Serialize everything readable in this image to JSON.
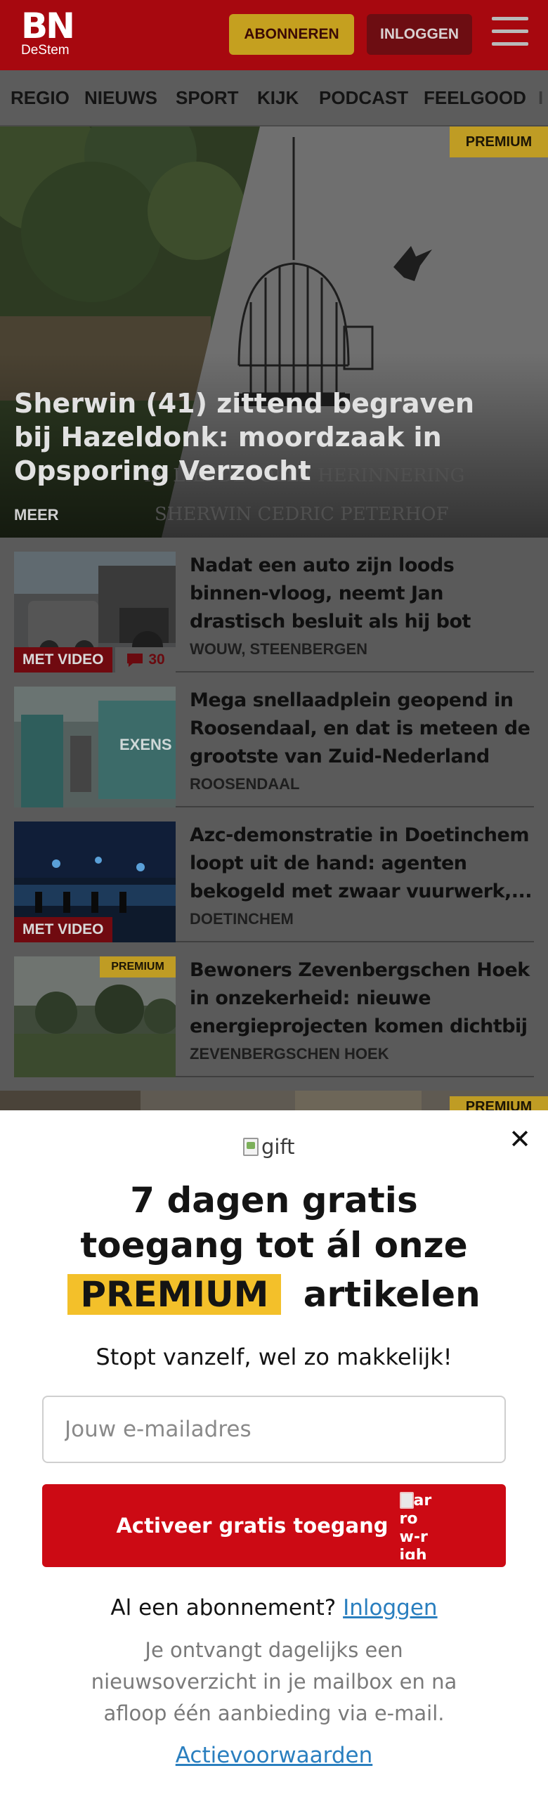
{
  "header": {
    "logo_main": "BN",
    "logo_sub": "DeStem",
    "subscribe_label": "ABONNEREN",
    "login_label": "INLOGGEN"
  },
  "nav": {
    "items": [
      "REGIO",
      "NIEUWS",
      "SPORT",
      "KIJK",
      "PODCAST",
      "FEELGOOD"
    ]
  },
  "hero": {
    "badge": "PREMIUM",
    "title": "Sherwin (41) zittend begraven bij Hazeldonk: moordzaak in Opsporing Verzocht",
    "more": "MEER",
    "image_caption_1": "IN LIEFDEVOLLE HERINNERING",
    "image_caption_2": "SHERWIN CEDRIC PETERHOF"
  },
  "articles": [
    {
      "title": "Nadat een auto zijn loods binnen-vloog, neemt Jan drastisch besluit als hij bot vangt bij politie",
      "location": "WOUW, STEENBERGEN",
      "video_tag": "MET VIDEO",
      "comments": "30"
    },
    {
      "title": "Mega snellaadplein geopend in Roosendaal, en dat is meteen de grootste van Zuid-Nederland",
      "location": "ROOSENDAAL",
      "thumb_text": "EXENS"
    },
    {
      "title": "Azc-demonstratie in Doetinchem loopt uit de hand: agenten bekogeld met zwaar vuurwerk,...",
      "location": "DOETINCHEM",
      "video_tag": "MET VIDEO"
    },
    {
      "title": "Bewoners Zevenbergschen Hoek in onzekerheid: nieuwe energieprojecten komen dichtbij",
      "location": "ZEVENBERGSCHEN HOEK",
      "badge": "PREMIUM"
    }
  ],
  "strip_badge": "PREMIUM",
  "modal": {
    "gift_alt": "gift",
    "headline_line1": "7 dagen gratis",
    "headline_line2": "toegang tot ál onze",
    "headline_highlight": "PREMIUM",
    "headline_rest": "artikelen",
    "subline": "Stopt vanzelf, wel zo makkelijk!",
    "email_placeholder": "Jouw e-mailadres",
    "activate_label": "Activeer gratis toegang",
    "arrow_alt": "arrow-right",
    "already_text": "Al een abonnement?",
    "login_link": "Inloggen",
    "info": "Je ontvangt dagelijks een nieuwsoverzicht in je mailbox en na afloop één aanbieding via e-mail.",
    "terms": "Actievoorwaarden"
  },
  "colors": {
    "brand_red": "#cc0a14",
    "premium_yellow": "#f3c02a",
    "link_blue": "#2a7fbf"
  }
}
